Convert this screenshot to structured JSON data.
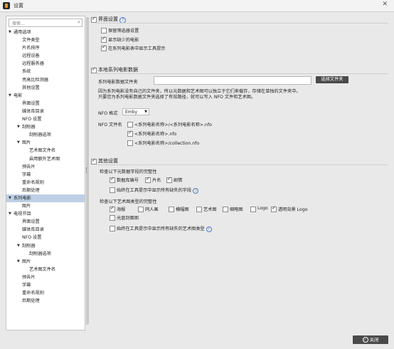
{
  "window": {
    "title": "设置"
  },
  "search": {
    "placeholder": "搜索..."
  },
  "tree": [
    {
      "label": "通用选项",
      "caret": "▼",
      "level": 0
    },
    {
      "label": "文件类型",
      "level": 1
    },
    {
      "label": "片名排序",
      "level": 1
    },
    {
      "label": "远程设备",
      "level": 1
    },
    {
      "label": "远程服务器",
      "level": 1
    },
    {
      "label": "系统",
      "level": 1
    },
    {
      "label": "亮高比检测器",
      "level": 1
    },
    {
      "label": "其他设置",
      "level": 1
    },
    {
      "label": "电影",
      "caret": "▼",
      "level": 0
    },
    {
      "label": "界面设置",
      "level": 1
    },
    {
      "label": "媒体库目录",
      "level": 1
    },
    {
      "label": "NFO 设置",
      "level": 1
    },
    {
      "label": "刮削器",
      "caret": "▼",
      "level": 1
    },
    {
      "label": "刮削器选项",
      "level": 2
    },
    {
      "label": "图片",
      "caret": "▼",
      "level": 1
    },
    {
      "label": "艺术图文件名",
      "level": 2
    },
    {
      "label": "启用额外艺术图",
      "level": 2
    },
    {
      "label": "预告片",
      "level": 1
    },
    {
      "label": "字幕",
      "level": 1
    },
    {
      "label": "重命名规则",
      "level": 1
    },
    {
      "label": "后期处理",
      "level": 1
    },
    {
      "label": "系列电影",
      "caret": "▼",
      "level": 0,
      "selected": true
    },
    {
      "label": "图片",
      "level": 1
    },
    {
      "label": "电视节目",
      "caret": "▼",
      "level": 0
    },
    {
      "label": "界面设置",
      "level": 1
    },
    {
      "label": "媒体库目录",
      "level": 1
    },
    {
      "label": "NFO 设置",
      "level": 1
    },
    {
      "label": "刮削器",
      "caret": "▼",
      "level": 1
    },
    {
      "label": "刮削器选项",
      "level": 2
    },
    {
      "label": "图片",
      "caret": "▼",
      "level": 1
    },
    {
      "label": "艺术图文件名",
      "level": 2
    },
    {
      "label": "预告片",
      "level": 1
    },
    {
      "label": "字幕",
      "level": 1
    },
    {
      "label": "重命名规则",
      "level": 1
    },
    {
      "label": "后期处理",
      "level": 1
    }
  ],
  "ui": {
    "header": "界面设置",
    "help_icon": "?",
    "options": [
      {
        "label": "保留筛选器设置",
        "checked": false
      },
      {
        "label": "显示缺少的电影",
        "checked": true
      },
      {
        "label": "在系列电影表中显示工具提示",
        "checked": true
      }
    ]
  },
  "local": {
    "header": "本地系列电影数据",
    "folder_label": "系列电影数据文件夹",
    "folder_value": "",
    "browse_label": "选择文件夹",
    "desc1": "因为系列电影没有自己的文件夹，所以元数据和艺术图可以独立于它们来载存，存储在单独的文件夹中。",
    "desc2": "只要您为系列电影数据文件夹选择了有效路径，就可以写入 NFO 文件和艺术图。",
    "nfo_format_label": "NFO 格式",
    "nfo_format_value": "Emby",
    "nfo_filename_label": "NFO 文件名",
    "nfo_files": [
      {
        "label": "<系列电影名称>/<系列电影名称>.nfo",
        "checked": false
      },
      {
        "label": "<系列电影名称>.nfo",
        "checked": true
      },
      {
        "label": "<系列电影名称>/collection.nfo",
        "checked": false
      }
    ]
  },
  "other": {
    "header": "其他设置",
    "meta_label": "检查以下元数据字段的完整性",
    "meta_fields": [
      {
        "label": "数据库编号",
        "checked": true
      },
      {
        "label": "片名",
        "checked": true
      },
      {
        "label": "剧情",
        "checked": true
      }
    ],
    "meta_tooltip": "始终在工具提示中显示所有缺失的字段",
    "art_label": "检查以下艺术图类型的完整性",
    "art_types": [
      {
        "label": "海报",
        "checked": true
      },
      {
        "label": "同人画",
        "checked": false
      },
      {
        "label": "横幅图",
        "checked": false
      },
      {
        "label": "艺术图",
        "checked": false
      },
      {
        "label": "缩略图",
        "checked": false
      },
      {
        "label": "Logo",
        "checked": false
      },
      {
        "label": "透明背景 Logo",
        "checked": true
      },
      {
        "label": "光盘封面图",
        "checked": false
      }
    ],
    "art_tooltip": "始终在工具提示中显示所有缺失的艺术图类型"
  },
  "footer": {
    "close_label": "关闭"
  }
}
